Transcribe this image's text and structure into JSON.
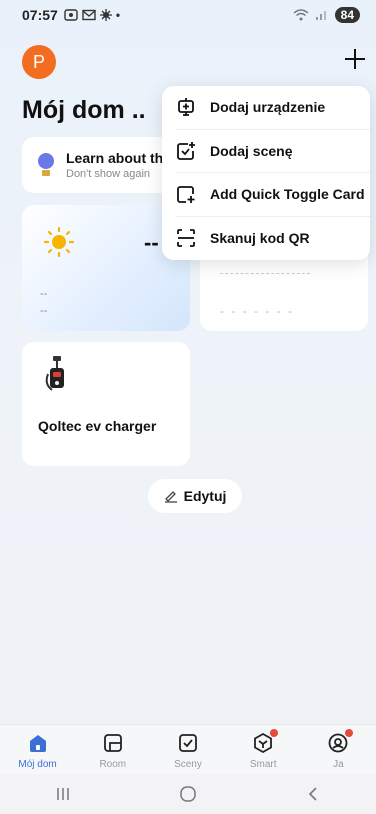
{
  "status": {
    "time": "07:57",
    "battery": "84"
  },
  "header": {
    "avatar_letter": "P",
    "home_title": "Mój dom .."
  },
  "learn_card": {
    "title": "Learn about th",
    "subtitle": "Don't show again"
  },
  "weather": {
    "temp": "--",
    "line1": "--",
    "line2": "--"
  },
  "env_card": {
    "dashes": "- - - - - - -"
  },
  "device": {
    "name": "Qoltec ev charger"
  },
  "edit_button": {
    "label": "Edytuj"
  },
  "dropdown": {
    "items": [
      {
        "label": "Dodaj urządzenie",
        "icon": "add-device-icon"
      },
      {
        "label": "Dodaj scenę",
        "icon": "add-scene-icon"
      },
      {
        "label": "Add Quick Toggle Card",
        "icon": "add-card-icon"
      },
      {
        "label": "Skanuj kod QR",
        "icon": "scan-qr-icon"
      }
    ]
  },
  "tabbar": {
    "items": [
      {
        "label": "Mój dom",
        "icon": "home-icon",
        "active": true
      },
      {
        "label": "Room",
        "icon": "room-icon"
      },
      {
        "label": "Sceny",
        "icon": "scene-icon"
      },
      {
        "label": "Smart",
        "icon": "smart-icon",
        "badge": true
      },
      {
        "label": "Ja",
        "icon": "profile-icon",
        "badge": true
      }
    ]
  },
  "colors": {
    "accent": "#3b6fd6",
    "avatar": "#f26d1f",
    "badge": "#e7493a"
  }
}
